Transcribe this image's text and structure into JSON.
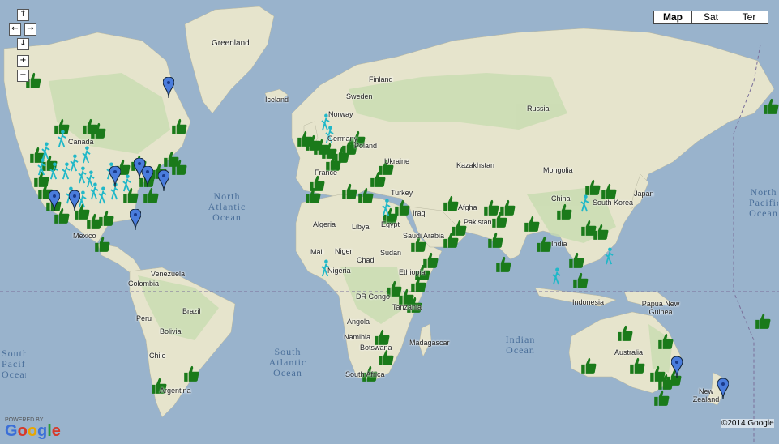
{
  "map_controls": {
    "pan_up": "↑",
    "pan_left": "←",
    "pan_right": "→",
    "pan_down": "↓",
    "zoom_in": "+",
    "zoom_out": "−",
    "map_types": [
      "Map",
      "Sat",
      "Ter"
    ],
    "selected_type": "Map"
  },
  "labels": {
    "countries": [
      "Greenland",
      "Iceland",
      "Finland",
      "Sweden",
      "Norway",
      "Russia",
      "Poland",
      "Germany",
      "France",
      "Ukraine",
      "Kazakhstan",
      "Mongolia",
      "China",
      "South Korea",
      "Japan",
      "Turkey",
      "Iraq",
      "Afgha",
      "Pakistan",
      "India",
      "Algeria",
      "Libya",
      "Egypt",
      "Saudi Arabia",
      "Mali",
      "Niger",
      "Chad",
      "Sudan",
      "Nigeria",
      "Ethiopia",
      "DR Congo",
      "Tanzania",
      "Angola",
      "Namibia",
      "Botswana",
      "South Africa",
      "Madagascar",
      "Papua New Guinea",
      "Indonesia",
      "Australia",
      "New Zealand",
      "Canada",
      "Mexico",
      "Venezuela",
      "Colombia",
      "Brazil",
      "Peru",
      "Bolivia",
      "Chile",
      "Argentina"
    ],
    "oceans": [
      "North Atlantic Ocean",
      "South Atlantic Ocean",
      "Indian Ocean",
      "North Pacific Ocean",
      "South Pacific Ocean"
    ]
  },
  "footer": {
    "powered_by": "POWERED BY",
    "brand": "Google",
    "copyright": "©2014 Google"
  },
  "colors": {
    "ocean": "#99b3cc",
    "land": "#e6e4cc",
    "forest": "#c8dcb0",
    "thumb_marker": "#1a7a1a",
    "person_marker": "#20b8c8",
    "pin_marker": "#4a7cdc"
  },
  "marker_icons": [
    "thumbs-up-icon",
    "person-icon",
    "map-pin-icon"
  ]
}
